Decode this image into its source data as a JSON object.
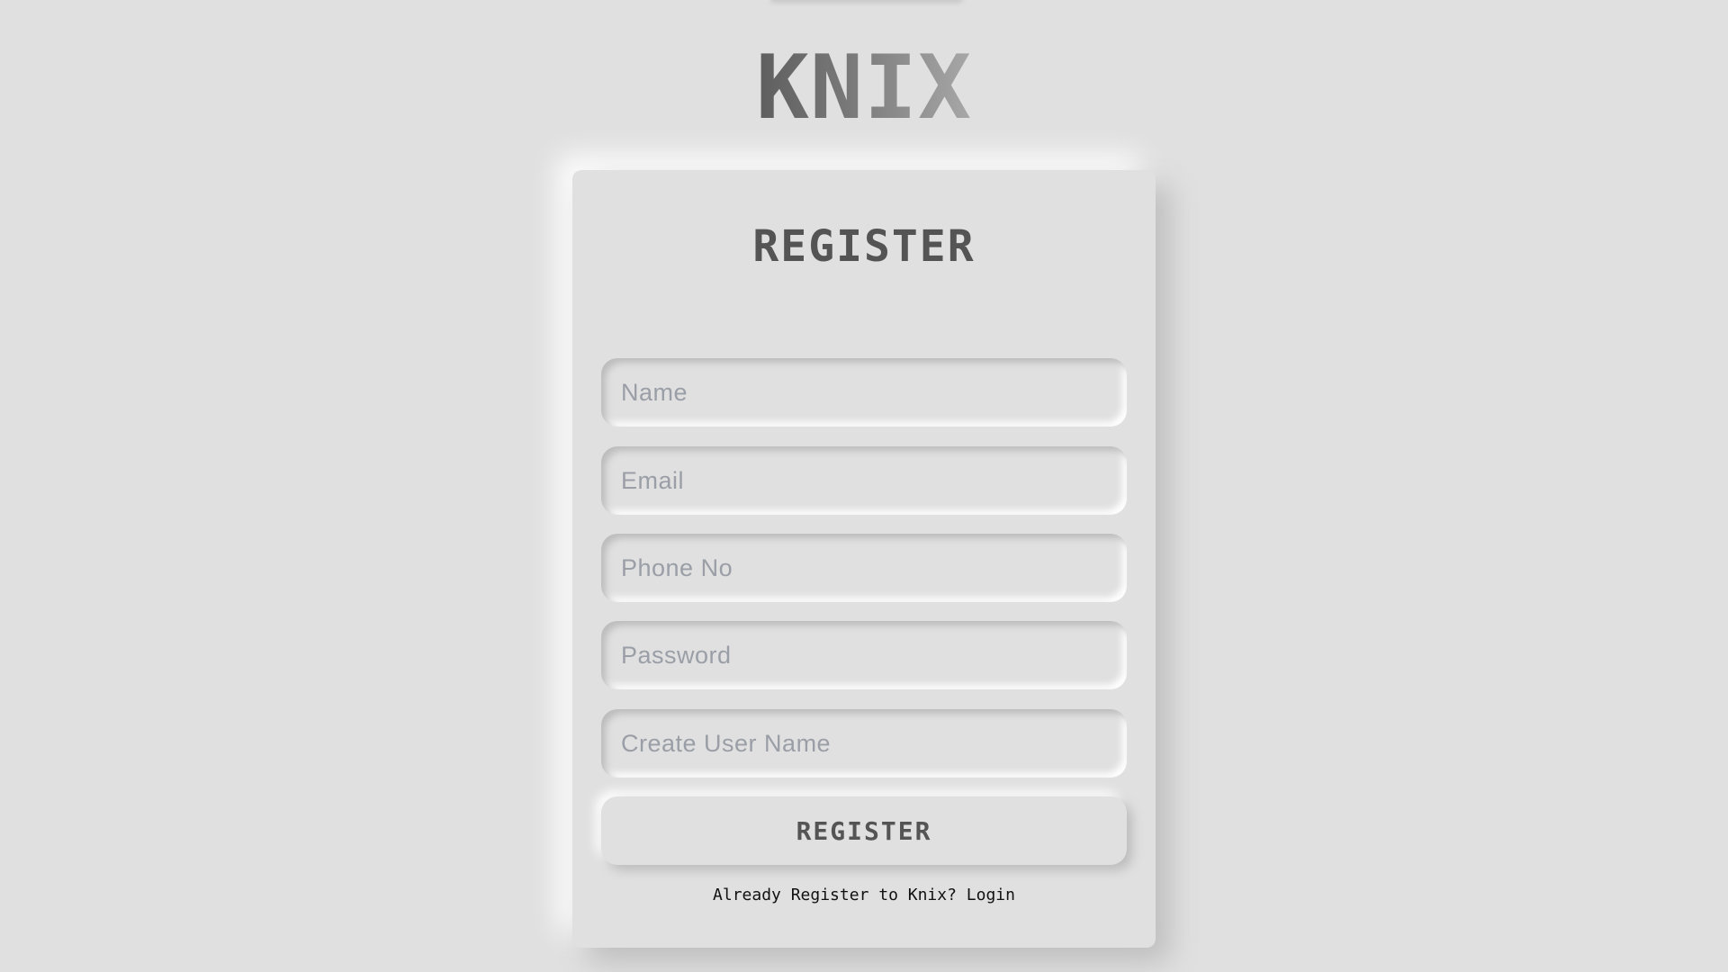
{
  "brand": {
    "logo_text": "KNIX"
  },
  "form": {
    "title": "REGISTER",
    "fields": [
      {
        "placeholder": "Name",
        "value": ""
      },
      {
        "placeholder": "Email",
        "value": ""
      },
      {
        "placeholder": "Phone No",
        "value": ""
      },
      {
        "placeholder": "Password",
        "value": ""
      },
      {
        "placeholder": "Create User Name",
        "value": ""
      }
    ],
    "submit_label": "REGISTER",
    "login_prompt": "Already Register to Knix? ",
    "login_link": "Login"
  },
  "colors": {
    "background": "#e0e0e0",
    "title_text": "#545454",
    "placeholder_text": "#9a9ea6",
    "logo_gradient_start": "#5e5e5e",
    "logo_gradient_end": "#a8a8a8"
  }
}
